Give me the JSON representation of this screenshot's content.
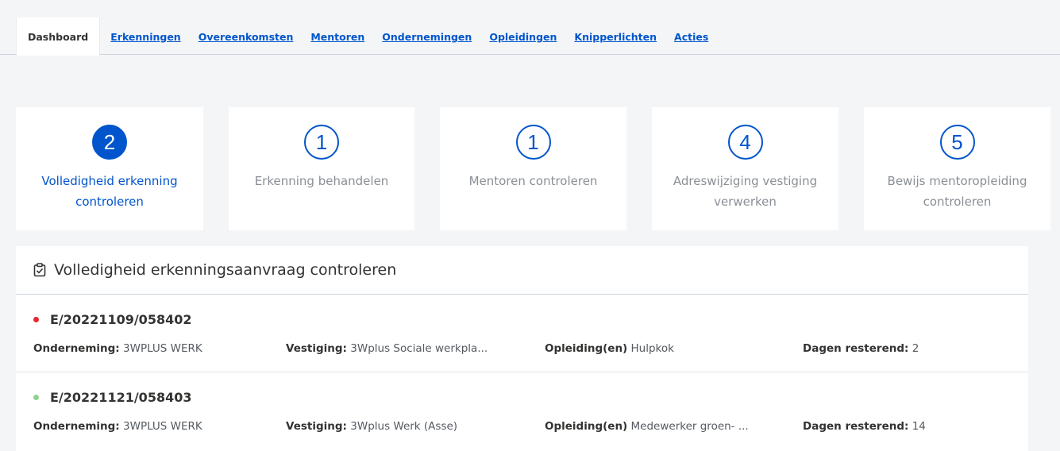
{
  "nav": {
    "tabs": [
      {
        "label": "Dashboard",
        "active": true
      },
      {
        "label": "Erkenningen"
      },
      {
        "label": "Overeenkomsten"
      },
      {
        "label": "Mentoren"
      },
      {
        "label": "Ondernemingen"
      },
      {
        "label": "Opleidingen"
      },
      {
        "label": "Knipperlichten"
      },
      {
        "label": "Acties"
      }
    ]
  },
  "cards": [
    {
      "count": "2",
      "label": "Volledigheid erkenning controleren",
      "active": true
    },
    {
      "count": "1",
      "label": "Erkenning behandelen"
    },
    {
      "count": "1",
      "label": "Mentoren controleren"
    },
    {
      "count": "4",
      "label": "Adreswijziging vestiging verwerken"
    },
    {
      "count": "5",
      "label": "Bewijs mentoropleiding controleren"
    }
  ],
  "panel": {
    "icon": "clipboard-check-icon",
    "title": "Volledigheid erkenningsaanvraag controleren",
    "rows": [
      {
        "id": "E/20221109/058402",
        "status_color": "#e8262e",
        "onderneming_label": "Onderneming:",
        "onderneming": "3WPLUS WERK",
        "vestiging_label": "Vestiging:",
        "vestiging": "3Wplus Sociale werkpla...",
        "opleiding_label": "Opleiding(en)",
        "opleiding": "Hulpkok",
        "dagen_label": "Dagen resterend:",
        "dagen": "2"
      },
      {
        "id": "E/20221121/058403",
        "status_color": "#8fd28f",
        "onderneming_label": "Onderneming:",
        "onderneming": "3WPLUS WERK",
        "vestiging_label": "Vestiging:",
        "vestiging": "3Wplus Werk (Asse)",
        "opleiding_label": "Opleiding(en)",
        "opleiding": "Medewerker groen- ...",
        "dagen_label": "Dagen resterend:",
        "dagen": "14"
      }
    ]
  },
  "colors": {
    "accent": "#0055cc",
    "page_bg": "#f4f5f7"
  }
}
